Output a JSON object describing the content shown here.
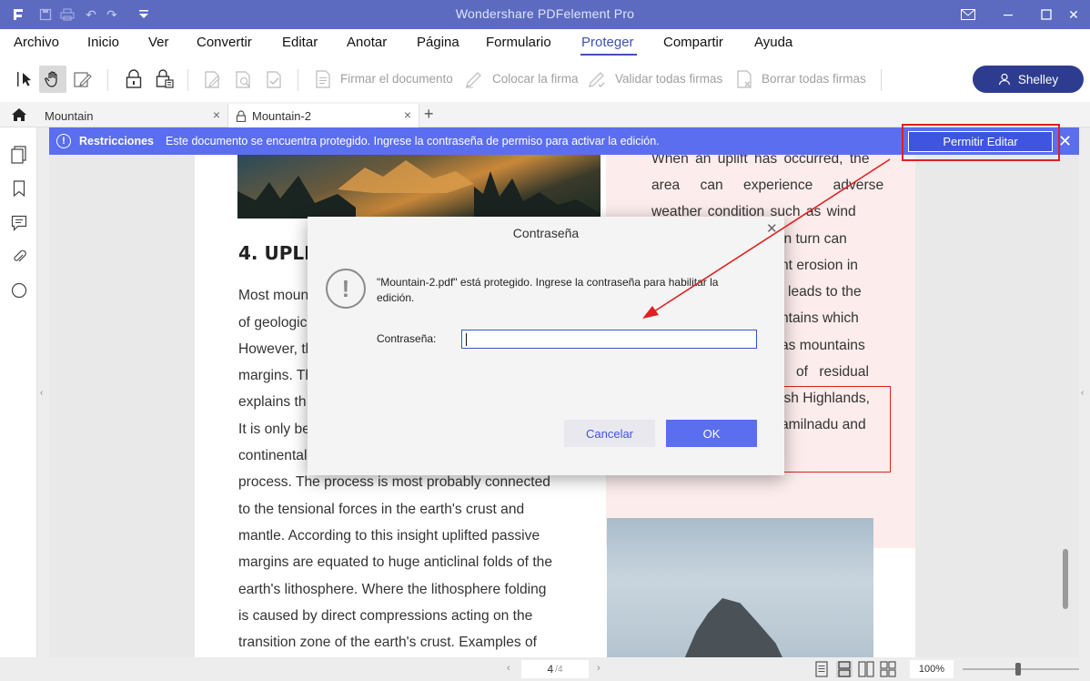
{
  "app": {
    "title": "Wondershare PDFelement Pro"
  },
  "menu": {
    "items": [
      "Archivo",
      "Inicio",
      "Ver",
      "Convertir",
      "Editar",
      "Anotar",
      "Página",
      "Formulario",
      "Proteger",
      "Compartir",
      "Ayuda"
    ],
    "active": "Proteger"
  },
  "toolbar": {
    "sign_document": "Firmar el documento",
    "place_signature": "Colocar la firma",
    "validate_signatures": "Validar todas firmas",
    "delete_signatures": "Borrar todas firmas",
    "user_name": "Shelley"
  },
  "tabs": [
    {
      "label": "Mountain"
    },
    {
      "label": "Mountain-2"
    }
  ],
  "banner": {
    "title": "Restricciones",
    "message": "Este documento se encuentra protegido. Ingrese la contraseña de permiso para activar la edición.",
    "permit_button": "Permitir Editar"
  },
  "document": {
    "heading": "4. UPLIF",
    "left_lines": [
      "Most moun",
      "of geologic",
      "However, th",
      "margins. Th",
      "explains th",
      "It is only bel",
      "continental",
      "process. The process is most probably connected",
      "to the tensional forces in the earth's crust and",
      "mantle. According to this insight uplifted passive",
      "margins are equated to huge anticlinal folds of the",
      "earth's lithosphere. Where the lithosphere folding",
      "is caused by direct compressions acting on the",
      "transition zone of the earth's crust. Examples of"
    ],
    "right_lines": [
      "When an uplift has occurred, the",
      "area can experience adverse",
      "weather condition such as wind",
      "n in turn can",
      "nt erosion in",
      "leads to the",
      "ntains which",
      "as mountains",
      "of residual",
      "ish Highlands,",
      "amilnadu and"
    ]
  },
  "dialog": {
    "title": "Contraseña",
    "message": "\"Mountain-2.pdf\" está protegido. Ingrese la contraseña para habilitar la edición.",
    "password_label": "Contraseña:",
    "password_value": "",
    "cancel_label": "Cancelar",
    "ok_label": "OK"
  },
  "status": {
    "current_page": "4",
    "total_pages": "/4",
    "zoom": "100%"
  },
  "colors": {
    "titlebar": "#5c6bc0",
    "accent": "#3f51b5",
    "banner": "#5b6ef0",
    "annotation_red": "#e02020"
  }
}
